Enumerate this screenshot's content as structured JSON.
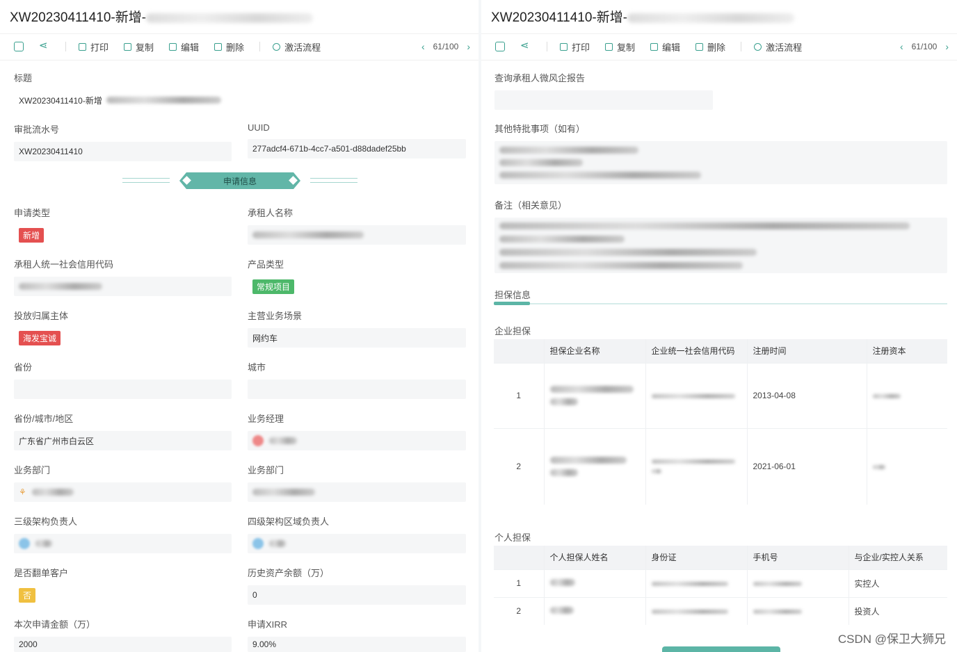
{
  "left": {
    "title_prefix": "XW20230411410-新增-",
    "toolbar": {
      "print": "打印",
      "copy": "复制",
      "edit": "编辑",
      "delete": "删除",
      "activate": "激活流程",
      "page": "61/100"
    },
    "fields": {
      "title_label": "标题",
      "title_value": "XW20230411410-新增",
      "serial_label": "审批流水号",
      "serial_value": "XW20230411410",
      "uuid_label": "UUID",
      "uuid_value": "277adcf4-671b-4cc7-a501-d88dadef25bb",
      "section": "申请信息",
      "apply_type_label": "申请类型",
      "apply_type_value": "新增",
      "lessee_name_label": "承租人名称",
      "credit_code_label": "承租人统一社会信用代码",
      "product_type_label": "产品类型",
      "product_type_value": "常规项目",
      "investor_label": "投放归属主体",
      "investor_value": "海发宝诚",
      "scene_label": "主营业务场景",
      "scene_value": "网约车",
      "province_label": "省份",
      "city_label": "城市",
      "region_label": "省份/城市/地区",
      "region_value": "广东省广州市白云区",
      "manager_label": "业务经理",
      "dept_label": "业务部门",
      "dept2_label": "业务部门",
      "lvl3_label": "三级架构负责人",
      "lvl4_label": "四级架构区域负责人",
      "renew_label": "是否翻单客户",
      "renew_value": "否",
      "history_label": "历史资产余额（万）",
      "history_value": "0",
      "amount_label": "本次申请金额（万）",
      "amount_value": "2000",
      "xirr_label": "申请XIRR",
      "xirr_value": "9.00%"
    }
  },
  "right": {
    "title_prefix": "XW20230411410-新增-",
    "toolbar": {
      "print": "打印",
      "copy": "复制",
      "edit": "编辑",
      "delete": "删除",
      "activate": "激活流程",
      "page": "61/100"
    },
    "report_label": "查询承租人微风企报告",
    "special_label": "其他特批事项（如有）",
    "remark_label": "备注（相关意见）",
    "guarantee_tab": "担保信息",
    "corp_title": "企业担保",
    "corp_headers": [
      "",
      "担保企业名称",
      "企业统一社会信用代码",
      "注册时间",
      "注册资本"
    ],
    "corp_rows": [
      {
        "no": "1",
        "date": "2013-04-08"
      },
      {
        "no": "2",
        "date": "2021-06-01"
      }
    ],
    "person_title": "个人担保",
    "person_headers": [
      "",
      "个人担保人姓名",
      "身份证",
      "手机号",
      "与企业/实控人关系"
    ],
    "person_rows": [
      {
        "no": "1",
        "relation": "实控人"
      },
      {
        "no": "2",
        "relation": "投资人"
      }
    ]
  },
  "watermark": "CSDN @保卫大狮兄",
  "colors": {
    "accent": "#3aa08f",
    "tag_red": "#e45050",
    "tag_green": "#4db86a",
    "tag_yellow": "#f0c040"
  }
}
